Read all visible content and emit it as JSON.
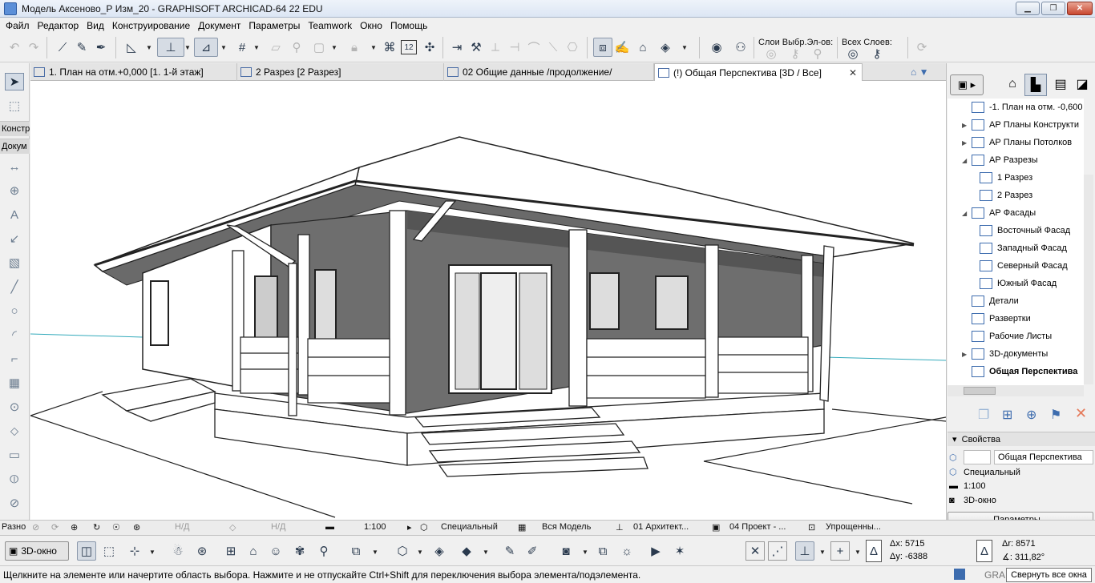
{
  "window": {
    "title": "Модель Аксеново_Р Изм_20 - GRAPHISOFT ARCHICAD-64 22 EDU",
    "minimize": "▁",
    "restore": "❐",
    "close": "✕"
  },
  "menu": [
    "Файл",
    "Редактор",
    "Вид",
    "Конструирование",
    "Документ",
    "Параметры",
    "Teamwork",
    "Окно",
    "Помощь"
  ],
  "toolbar": {
    "layers_label": "Слои Выбр.Эл-ов:",
    "all_layers_label": "Всех Слоев:",
    "scale_badge": "12"
  },
  "tabs": [
    {
      "label": "1. План на отм.+0,000 [1. 1-й этаж]"
    },
    {
      "label": "2 Разрез [2 Разрез]"
    },
    {
      "label": "02     Общие данные /продолжение/"
    },
    {
      "label": "(!) Общая Перспектива [3D / Все]"
    }
  ],
  "tab_close": "✕",
  "left_tabs": {
    "construct": "Констру",
    "document": "Докум",
    "misc": "Разно"
  },
  "left_tool_icons": [
    "arrow-icon",
    "marquee-icon",
    "dimension-icon",
    "level-icon",
    "text-icon",
    "label-icon",
    "fill-icon",
    "line-icon",
    "circle-icon",
    "arc-icon",
    "polyline-icon",
    "drawing-icon",
    "detail-icon",
    "figure-icon",
    "change-icon",
    "section-icon",
    "elevation-icon"
  ],
  "navigator": {
    "items": [
      {
        "label": "-1. План на отм. -0,600",
        "level": 0,
        "bold": false,
        "expander": ""
      },
      {
        "label": "АР Планы Конструкти",
        "level": 0,
        "bold": false,
        "expander": "▶"
      },
      {
        "label": "АР Планы Потолков",
        "level": 0,
        "bold": false,
        "expander": "▶"
      },
      {
        "label": "АР Разрезы",
        "level": 0,
        "bold": false,
        "expander": "◢"
      },
      {
        "label": "1 Разрез",
        "level": 1,
        "bold": false,
        "expander": ""
      },
      {
        "label": "2 Разрез",
        "level": 1,
        "bold": false,
        "expander": ""
      },
      {
        "label": "АР Фасады",
        "level": 0,
        "bold": false,
        "expander": "◢"
      },
      {
        "label": "Восточный Фасад",
        "level": 1,
        "bold": false,
        "expander": ""
      },
      {
        "label": "Западный Фасад",
        "level": 1,
        "bold": false,
        "expander": ""
      },
      {
        "label": "Северный Фасад",
        "level": 1,
        "bold": false,
        "expander": ""
      },
      {
        "label": "Южный Фасад",
        "level": 1,
        "bold": false,
        "expander": ""
      },
      {
        "label": "Детали",
        "level": 0,
        "bold": false,
        "expander": ""
      },
      {
        "label": "Развертки",
        "level": 0,
        "bold": false,
        "expander": ""
      },
      {
        "label": "Рабочие Листы",
        "level": 0,
        "bold": false,
        "expander": ""
      },
      {
        "label": "3D-документы",
        "level": 0,
        "bold": false,
        "expander": "▶"
      },
      {
        "label": "Общая Перспектива",
        "level": 0,
        "bold": true,
        "expander": ""
      }
    ]
  },
  "properties": {
    "header": "Свойства",
    "name_value": "Общая Перспектива",
    "type": "Специальный",
    "scale": "1:100",
    "view": "3D-окно",
    "params_button": "Параметры..."
  },
  "bottom_bar": {
    "misc": "Разно",
    "nd1": "Н/Д",
    "nd2": "Н/Д",
    "scale": "1:100",
    "pen_set": "Специальный",
    "model": "Вся Модель",
    "arch": "01 Архитект...",
    "project": "04 Проект - ...",
    "simplified": "Упрощенны..."
  },
  "toolbar2": {
    "view_3d": "3D-окно",
    "dx": "Δx: 5715",
    "dy": "Δy: -6388",
    "dr": "Δr: 8571",
    "angle": "∡: 311,82°"
  },
  "status": {
    "message": "Щелкните на элементе или начертите область выбора. Нажмите и не отпускайте Ctrl+Shift для переключения выбора элемента/подэлемента.",
    "brand": "GRA",
    "tooltip": "Свернуть все окна"
  },
  "colors": {
    "accent": "#3d6cae",
    "titlebar": "#dce6f4",
    "wall_shade": "#6e6e6e",
    "roof": "#ffffff"
  }
}
